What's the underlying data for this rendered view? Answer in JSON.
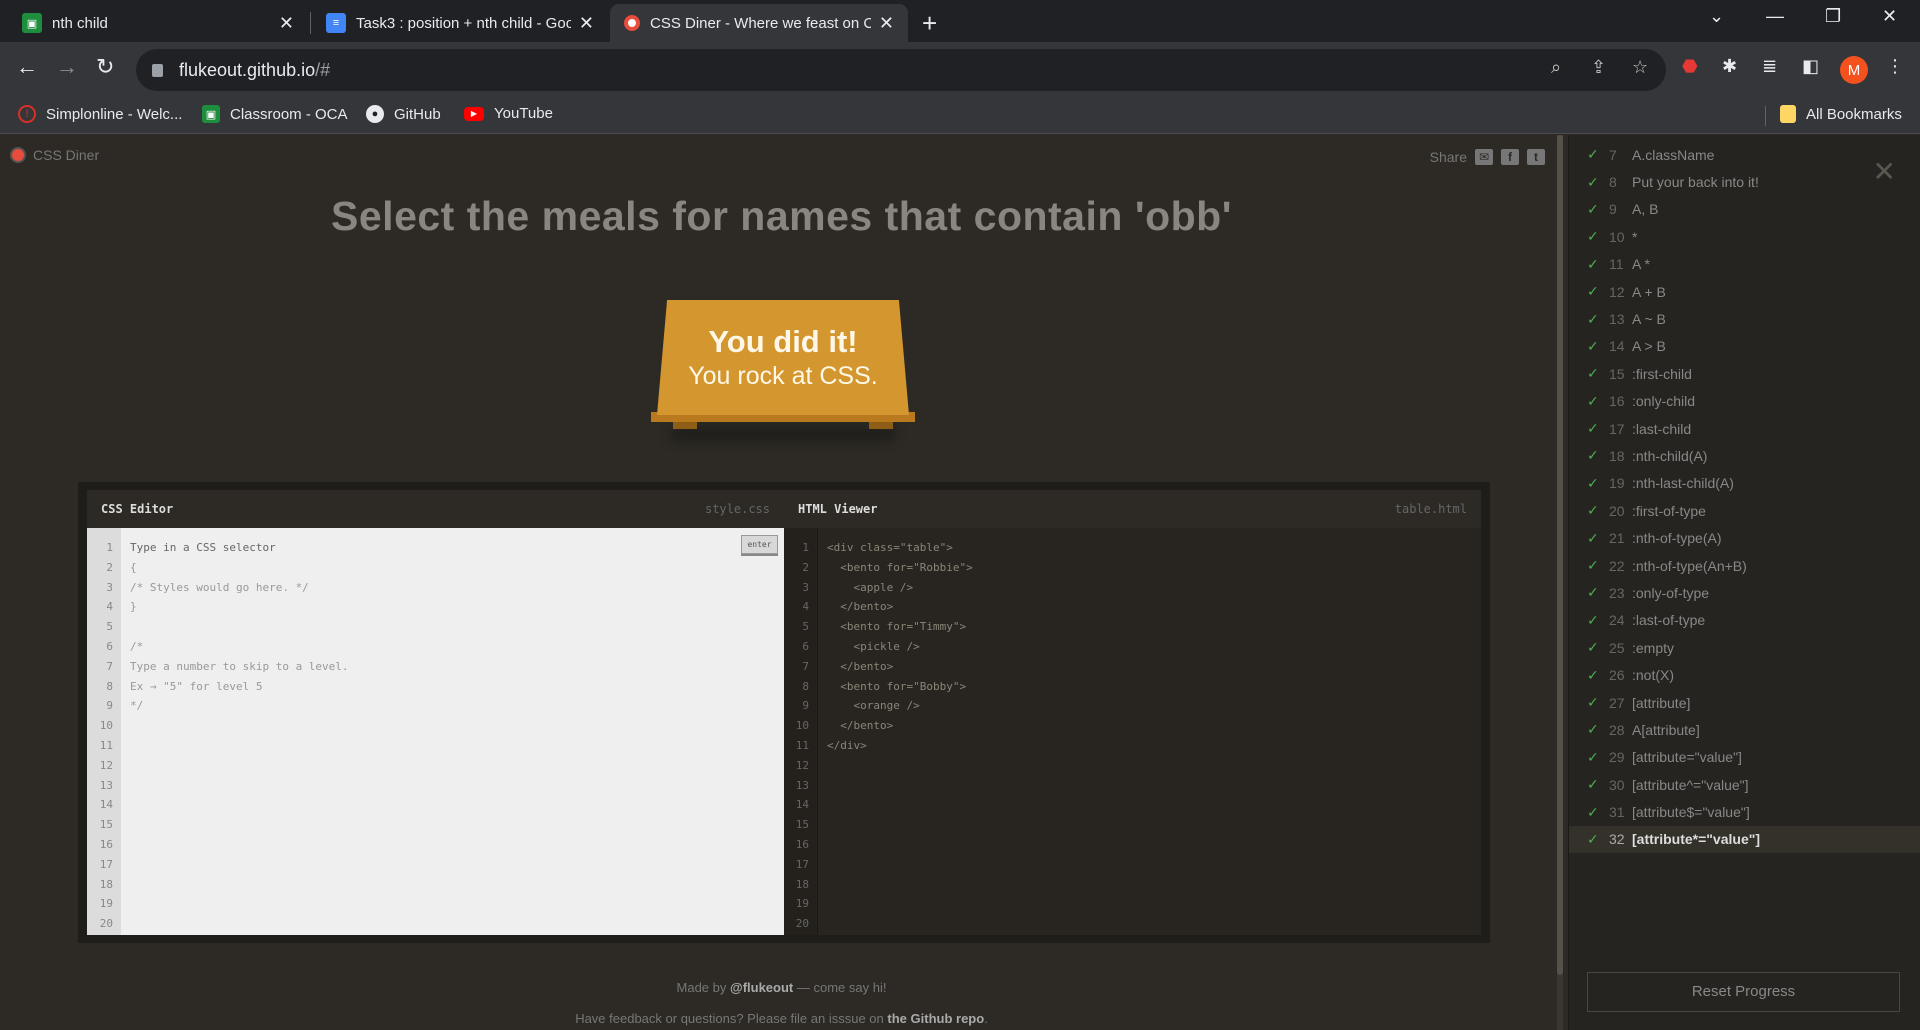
{
  "browser": {
    "tabs": [
      {
        "title": "nth child",
        "icon": "classroom-icon",
        "color": "#1e8e3e"
      },
      {
        "title": "Task3 : position + nth child - Goo",
        "icon": "docs-icon",
        "color": "#4285f4"
      },
      {
        "title": "CSS Diner - Where we feast on C",
        "icon": "css-diner-icon",
        "color": "#e74c3c"
      }
    ],
    "url_host": "flukeout.github.io",
    "url_path": "/#",
    "bookmarks": [
      {
        "label": "Simplonline - Welc...",
        "icon": "simplon-icon",
        "color": "#d93025"
      },
      {
        "label": "Classroom - OCA",
        "icon": "classroom-icon",
        "color": "#1e8e3e"
      },
      {
        "label": "GitHub",
        "icon": "github-icon",
        "color": "#555555"
      },
      {
        "label": "YouTube",
        "icon": "youtube-icon",
        "color": "#ff0000"
      }
    ],
    "all_bookmarks": "All Bookmarks",
    "profile_initial": "M"
  },
  "header": {
    "logo": "CSS Diner",
    "share": "Share"
  },
  "instruction": "Select the meals for names that contain 'obb'",
  "win": {
    "line1": "You did it!",
    "line2": "You rock at CSS."
  },
  "css_editor": {
    "title": "CSS Editor",
    "file": "style.css",
    "enter": "enter",
    "line_numbers": [
      "1",
      "2",
      "3",
      "4",
      "5",
      "6",
      "7",
      "8",
      "9",
      "10",
      "11",
      "12",
      "13",
      "14",
      "15",
      "16",
      "17",
      "18",
      "19",
      "20"
    ],
    "lines": [
      "Type in a CSS selector",
      "{",
      "/* Styles would go here. */",
      "}",
      "",
      "/*",
      "Type a number to skip to a level.",
      "Ex → \"5\" for level 5",
      "*/"
    ]
  },
  "html_viewer": {
    "title": "HTML Viewer",
    "file": "table.html",
    "line_numbers": [
      "1",
      "2",
      "3",
      "4",
      "5",
      "6",
      "7",
      "8",
      "9",
      "10",
      "11",
      "12",
      "13",
      "14",
      "15",
      "16",
      "17",
      "18",
      "19",
      "20"
    ],
    "lines": [
      "<div class=\"table\">",
      "  <bento for=\"Robbie\">",
      "    <apple />",
      "  </bento>",
      "  <bento for=\"Timmy\">",
      "    <pickle />",
      "  </bento>",
      "  <bento for=\"Bobby\">",
      "    <orange />",
      "  </bento>",
      "</div>"
    ]
  },
  "footer": {
    "made_by": "Made by",
    "handle": "@flukeout",
    "say_hi": "— come say hi!",
    "feedback": "Have feedback or questions? Please file an isssue on",
    "repo": "the Github repo",
    "period": "."
  },
  "sidebar": {
    "levels": [
      {
        "num": "7",
        "sel": "A.className"
      },
      {
        "num": "8",
        "sel": "Put your back into it!"
      },
      {
        "num": "9",
        "sel": "A, B"
      },
      {
        "num": "10",
        "sel": "*"
      },
      {
        "num": "11",
        "sel": "A *"
      },
      {
        "num": "12",
        "sel": "A + B"
      },
      {
        "num": "13",
        "sel": "A ~ B"
      },
      {
        "num": "14",
        "sel": "A > B"
      },
      {
        "num": "15",
        "sel": ":first-child"
      },
      {
        "num": "16",
        "sel": ":only-child"
      },
      {
        "num": "17",
        "sel": ":last-child"
      },
      {
        "num": "18",
        "sel": ":nth-child(A)"
      },
      {
        "num": "19",
        "sel": ":nth-last-child(A)"
      },
      {
        "num": "20",
        "sel": ":first-of-type"
      },
      {
        "num": "21",
        "sel": ":nth-of-type(A)"
      },
      {
        "num": "22",
        "sel": ":nth-of-type(An+B)"
      },
      {
        "num": "23",
        "sel": ":only-of-type"
      },
      {
        "num": "24",
        "sel": ":last-of-type"
      },
      {
        "num": "25",
        "sel": ":empty"
      },
      {
        "num": "26",
        "sel": ":not(X)"
      },
      {
        "num": "27",
        "sel": "[attribute]"
      },
      {
        "num": "28",
        "sel": "A[attribute]"
      },
      {
        "num": "29",
        "sel": "[attribute=\"value\"]"
      },
      {
        "num": "30",
        "sel": "[attribute^=\"value\"]"
      },
      {
        "num": "31",
        "sel": "[attribute$=\"value\"]"
      },
      {
        "num": "32",
        "sel": "[attribute*=\"value\"]"
      }
    ],
    "current_level": "32",
    "reset": "Reset Progress"
  }
}
